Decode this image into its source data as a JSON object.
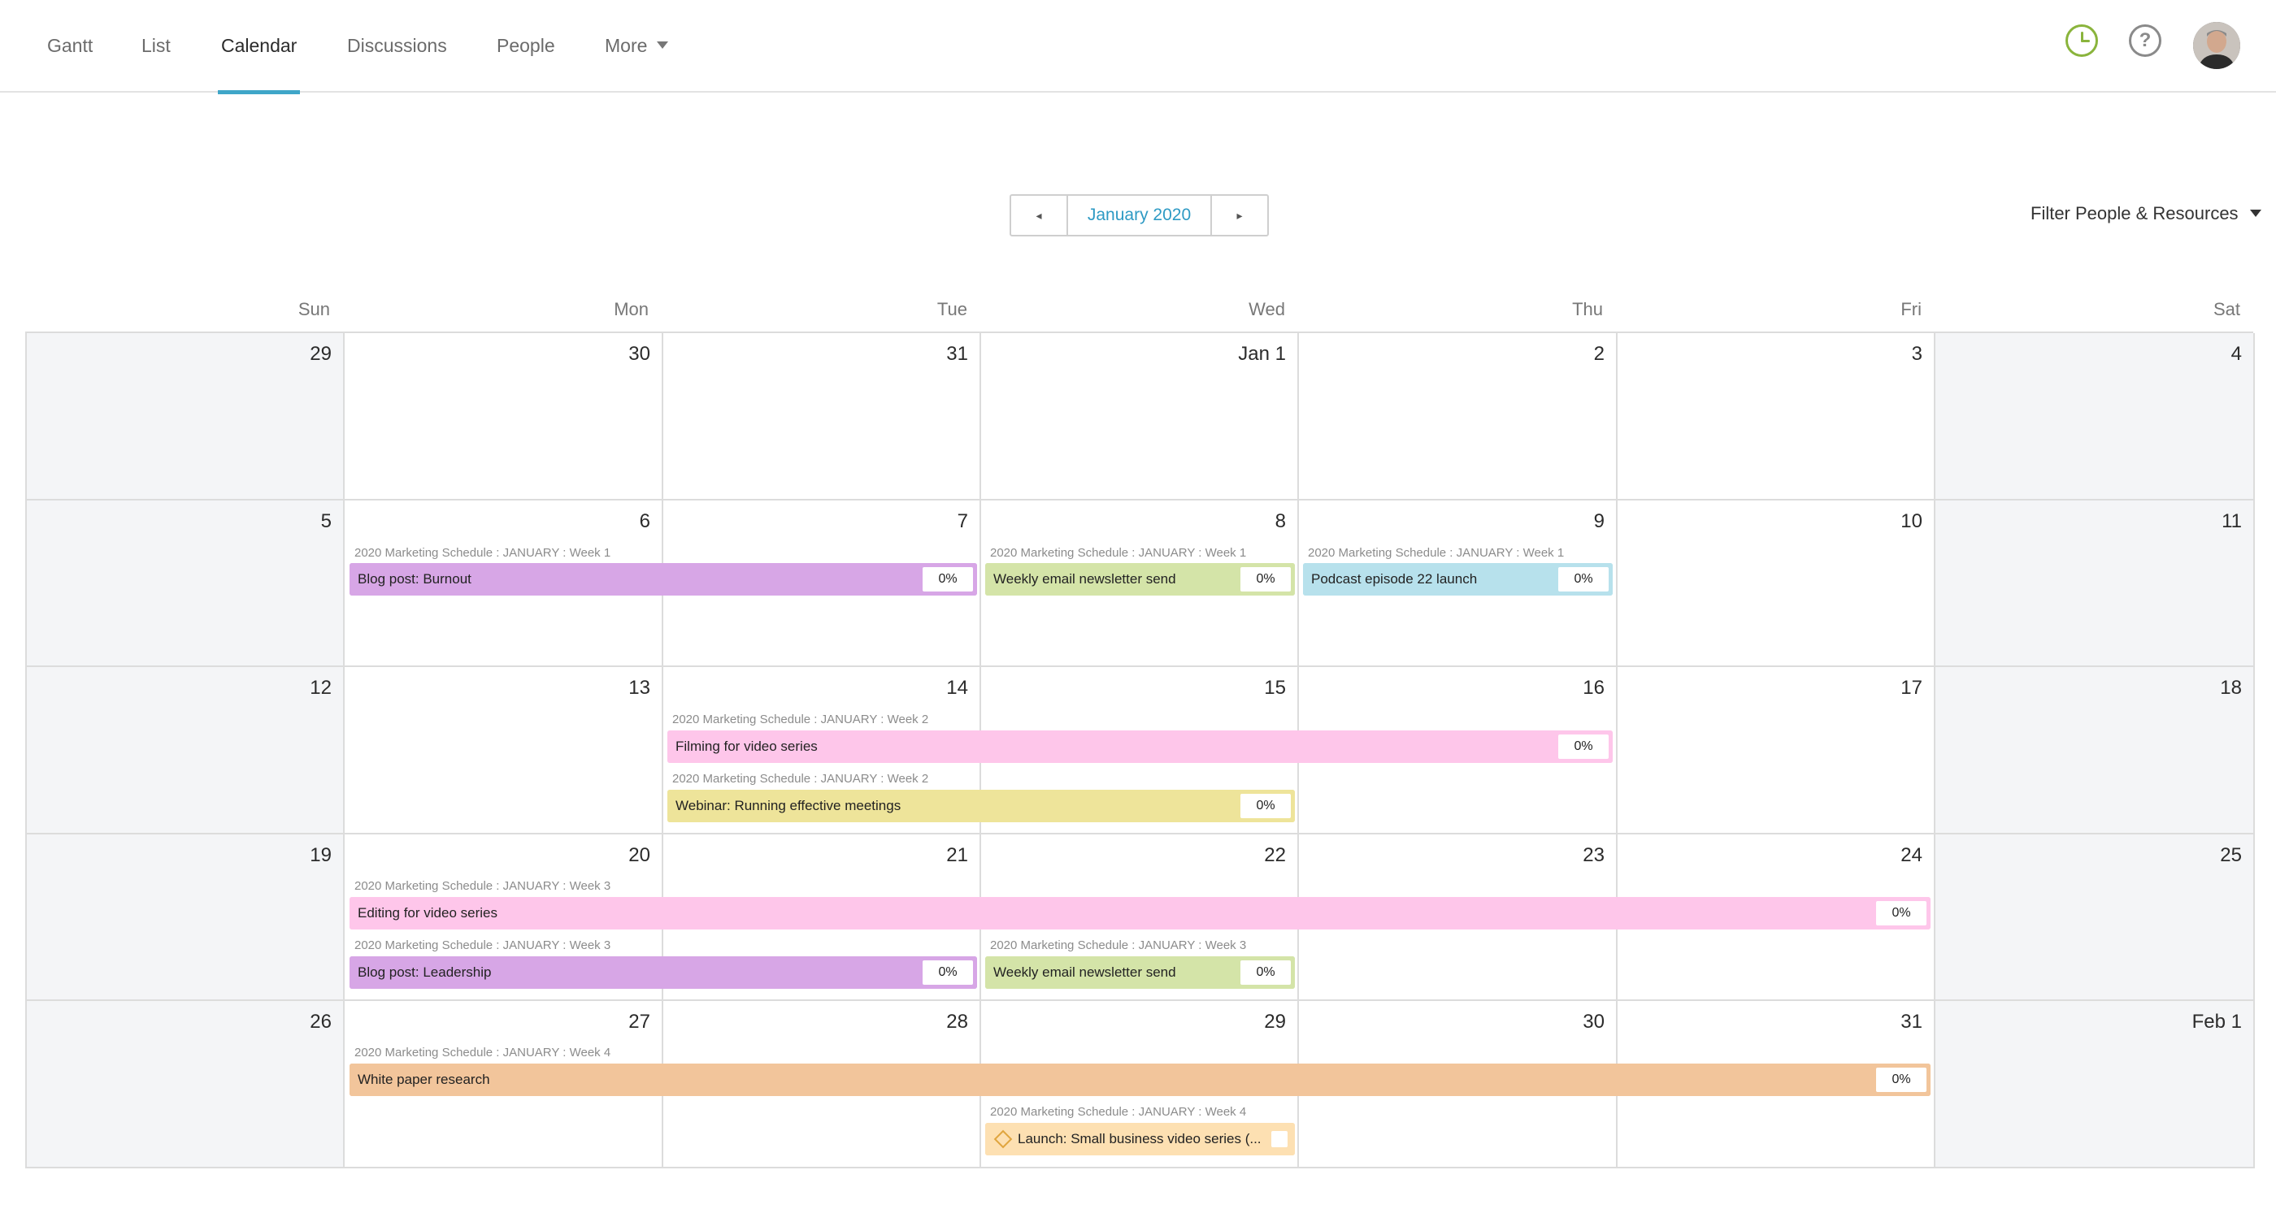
{
  "nav": {
    "tabs": [
      {
        "label": "Gantt"
      },
      {
        "label": "List"
      },
      {
        "label": "Calendar"
      },
      {
        "label": "Discussions"
      },
      {
        "label": "People"
      },
      {
        "label": "More"
      }
    ],
    "active_tab": "Calendar",
    "accent_color": "#3fa6c8"
  },
  "icons": {
    "clock": "clock-icon",
    "help": "help-icon",
    "help_glyph": "?",
    "avatar": "avatar"
  },
  "month_nav": {
    "prev_glyph": "◂",
    "label": "January 2020",
    "next_glyph": "▸"
  },
  "filter": {
    "label": "Filter People & Resources"
  },
  "calendar": {
    "days_of_week": [
      "Sun",
      "Mon",
      "Tue",
      "Wed",
      "Thu",
      "Fri",
      "Sat"
    ],
    "weeks": [
      [
        "29",
        "30",
        "31",
        "Jan 1",
        "2",
        "3",
        "4"
      ],
      [
        "5",
        "6",
        "7",
        "8",
        "9",
        "10",
        "11"
      ],
      [
        "12",
        "13",
        "14",
        "15",
        "16",
        "17",
        "18"
      ],
      [
        "19",
        "20",
        "21",
        "22",
        "23",
        "24",
        "25"
      ],
      [
        "26",
        "27",
        "28",
        "29",
        "30",
        "31",
        "Feb 1"
      ]
    ]
  },
  "events": [
    {
      "meta": "2020 Marketing Schedule : JANUARY : Week 1",
      "title": "Blog post: Burnout",
      "pct": "0%",
      "color": "#d7a6e6"
    },
    {
      "meta": "2020 Marketing Schedule : JANUARY : Week 1",
      "title": "Weekly email newsletter send",
      "pct": "0%",
      "color": "#d4e4a8"
    },
    {
      "meta": "2020 Marketing Schedule : JANUARY : Week 1",
      "title": "Podcast episode 22 launch",
      "pct": "0%",
      "color": "#b7e1ec"
    },
    {
      "meta": "2020 Marketing Schedule : JANUARY : Week 2",
      "title": "Filming for video series",
      "pct": "0%",
      "color": "#fec6ea"
    },
    {
      "meta": "2020 Marketing Schedule : JANUARY : Week 2",
      "title": "Webinar: Running effective meetings",
      "pct": "0%",
      "color": "#eee49a"
    },
    {
      "meta": "2020 Marketing Schedule : JANUARY : Week 3",
      "title": "Editing for video series",
      "pct": "0%",
      "color": "#fec6ea"
    },
    {
      "meta": "2020 Marketing Schedule : JANUARY : Week 3",
      "title": "Blog post: Leadership",
      "pct": "0%",
      "color": "#d7a6e6"
    },
    {
      "meta": "2020 Marketing Schedule : JANUARY : Week 3",
      "title": "Weekly email newsletter send",
      "pct": "0%",
      "color": "#d4e4a8"
    },
    {
      "meta": "2020 Marketing Schedule : JANUARY : Week 4",
      "title": "White paper research",
      "pct": "0%",
      "color": "#f2c59b"
    },
    {
      "meta": "2020 Marketing Schedule : JANUARY : Week 4",
      "title": "Launch:  Small business video series (...",
      "pct": "",
      "color": "#fde0b2",
      "milestone": true
    }
  ]
}
